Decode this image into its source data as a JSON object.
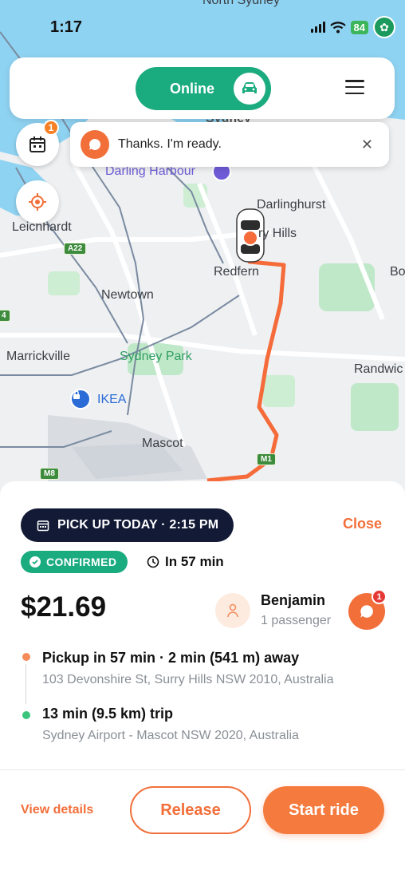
{
  "status_bar": {
    "time": "1:17",
    "battery": "84"
  },
  "map": {
    "labels": {
      "north_sydney": "North Sydney",
      "sydney": "Sydney",
      "darling_harbour": "Darling Harbour",
      "darlinghurst": "Darlinghurst",
      "surry_hills": "ry Hills",
      "leichhardt": "Leichhardt",
      "redfern": "Redfern",
      "bo": "Bo",
      "newtown": "Newtown",
      "marrickville": "Marrickville",
      "sydney_park": "Sydney Park",
      "randwick": "Randwic",
      "ikea": "IKEA",
      "mascot": "Mascot"
    },
    "shields": {
      "a22": "A22",
      "m1": "M1",
      "m8": "M8",
      "a4": "4"
    }
  },
  "top_bar": {
    "online_label": "Online",
    "car_icon": "car-icon",
    "menu_icon": "hamburger-menu-icon"
  },
  "floaters": {
    "calendar_badge": "1",
    "toast_text": "Thanks. I'm ready."
  },
  "ride": {
    "pickup_chip": "PICK UP TODAY · 2:15 PM",
    "close_label": "Close",
    "confirmed_label": "CONFIRMED",
    "in_time": "In 57 min",
    "price": "$21.69",
    "passenger_name": "Benjamin",
    "passenger_count": "1 passenger",
    "chat_badge": "1",
    "pickup_title": "Pickup in 57 min · 2 min (541 m) away",
    "pickup_address": "103 Devonshire St, Surry Hills NSW 2010, Australia",
    "trip_title": "13 min (9.5 km) trip",
    "trip_address": "Sydney Airport - Mascot NSW 2020, Australia",
    "pickup_dot_color": "#f58a5a",
    "dropoff_dot_color": "#3cc47c"
  },
  "actions": {
    "view_details": "View details",
    "release": "Release",
    "start_ride": "Start ride"
  },
  "colors": {
    "brand_green": "#1aab7e",
    "accent_orange": "#f26f3a",
    "navy": "#121a36"
  }
}
